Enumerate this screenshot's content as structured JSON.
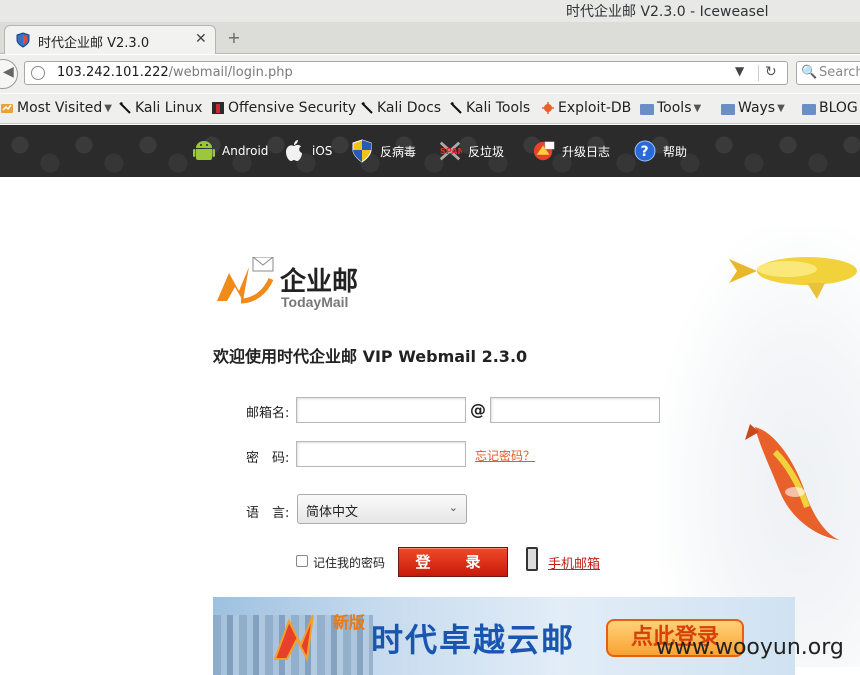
{
  "window": {
    "title": "时代企业邮 V2.3.0 - Iceweasel"
  },
  "tab": {
    "title": "时代企业邮 V2.3.0",
    "close": "✕",
    "new_tab": "+"
  },
  "navbar": {
    "url_host": "103.242.101.222",
    "url_path": "/webmail/login.php",
    "search_placeholder": "Search"
  },
  "bookmarks": [
    {
      "label": "Most Visited",
      "icon": "most-visited-icon",
      "has_menu": true
    },
    {
      "label": "Kali Linux",
      "icon": "kali-dragon-icon",
      "has_menu": false
    },
    {
      "label": "Offensive Security",
      "icon": "offsec-icon",
      "has_menu": false
    },
    {
      "label": "Kali Docs",
      "icon": "kali-dragon-icon",
      "has_menu": false
    },
    {
      "label": "Kali Tools",
      "icon": "kali-dragon-icon",
      "has_menu": false
    },
    {
      "label": "Exploit-DB",
      "icon": "exploit-db-icon",
      "has_menu": false
    },
    {
      "label": "Tools",
      "icon": "folder-icon",
      "has_menu": true
    },
    {
      "label": "Ways",
      "icon": "folder-icon",
      "has_menu": true
    },
    {
      "label": "BLOG",
      "icon": "folder-icon",
      "has_menu": true
    }
  ],
  "topnav": [
    {
      "label": "Android",
      "icon": "android-icon"
    },
    {
      "label": "iOS",
      "icon": "apple-icon"
    },
    {
      "label": "反病毒",
      "icon": "shield-icon"
    },
    {
      "label": "反垃圾",
      "icon": "anti-spam-icon"
    },
    {
      "label": "升级日志",
      "icon": "upgrade-log-icon"
    },
    {
      "label": "帮助",
      "icon": "help-icon"
    }
  ],
  "logo": {
    "name": "企业邮",
    "sub": "TodayMail"
  },
  "login": {
    "welcome": "欢迎使用时代企业邮 VIP Webmail 2.3.0",
    "mailbox_label": "邮箱名:",
    "at": "@",
    "password_label": "密　码:",
    "forgot": "忘记密码？",
    "language_label": "语　言:",
    "language_value": "简体中文",
    "remember": "记住我的密码",
    "submit": "登　录",
    "mobile_mail": "手机邮箱"
  },
  "banner": {
    "new": "新版",
    "title": "时代卓越云邮",
    "cta": "点此登录"
  },
  "watermark": "www.wooyun.org",
  "colors": {
    "login_button": "#d8200e",
    "link": "#e05a2a",
    "nav_bg": "#2b2b2b",
    "banner_title": "#1a56b0"
  }
}
